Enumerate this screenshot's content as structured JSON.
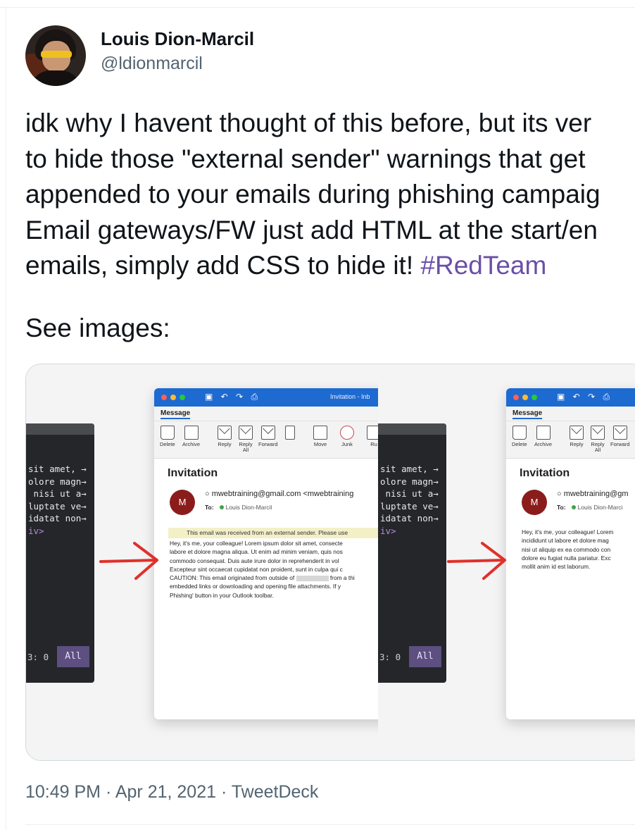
{
  "author": {
    "display_name": "Louis Dion-Marcil",
    "handle": "@ldionmarcil"
  },
  "tweet": {
    "lines": [
      "idk why I havent thought of this before, but its ver",
      "to hide those \"external sender\" warnings that get",
      "appended to your emails during phishing campaig",
      "Email gateways/FW just add HTML at the start/en"
    ],
    "last_line_text": "emails, simply add CSS to hide it! ",
    "hashtag": "#RedTeam",
    "hashtag_color": "#6a4fa8",
    "see_images": "See images:"
  },
  "media": {
    "terminal": {
      "code_lines": [
        "sit amet, →",
        "olore magn→",
        " nisi ut a→",
        "luptate ve→",
        "idatat non→"
      ],
      "closing_tag": "iv>",
      "status_num": "3: 0",
      "status_all": "All"
    },
    "outlook": {
      "window_title": "Invitation - Inb",
      "tab": "Message",
      "ribbon": {
        "delete": "Delete",
        "archive": "Archive",
        "reply": "Reply",
        "reply_all": "Reply\nAll",
        "forward": "Forward",
        "move": "Move",
        "junk": "Junk",
        "rules": "Ru"
      },
      "subject": "Invitation",
      "avatar_letter": "M",
      "avatar_color": "#8b1c1c",
      "sender": "mwebtraining@gmail.com <mwebtraining",
      "to_label": "To:",
      "recipient": "Louis Dion-Marcil",
      "external_warning": "This email was received from an external sender. Please use",
      "body_with_warning": [
        "Hey, it's me, your colleague! Lorem ipsum dolor sit amet, consecte",
        "labore et dolore magna aliqua. Ut enim ad minim veniam, quis nos",
        "commodo consequat. Duis aute irure dolor in reprehenderit in vol",
        "Excepteur sint occaecat cupidatat non proident, sunt in culpa qui c",
        "CAUTION: This email originated from outside of",
        " from a thi",
        "embedded links or downloading and opening file attachments. If y",
        "Phishing' button in your Outlook toolbar."
      ],
      "body_hidden": [
        "Hey, it's me, your colleague! Lorem",
        "incididunt ut labore et dolore mag",
        "nisi ut aliquip ex ea commodo con",
        "dolore eu fugiat nulla pariatur. Exc",
        "mollit anim id est laborum."
      ],
      "sender_cropped": "mwebtraining@gm",
      "recipient_cropped": "Louis Dion-Marci",
      "ribbon_cropped": {
        "delete": "Delete",
        "archive": "Archive",
        "reply": "Reply",
        "reply_all": "Reply\nAll",
        "forward": "Forward"
      }
    },
    "arrow_color": "#e0302a"
  },
  "timestamp": "10:49 PM · Apr 21, 2021 · TweetDeck"
}
